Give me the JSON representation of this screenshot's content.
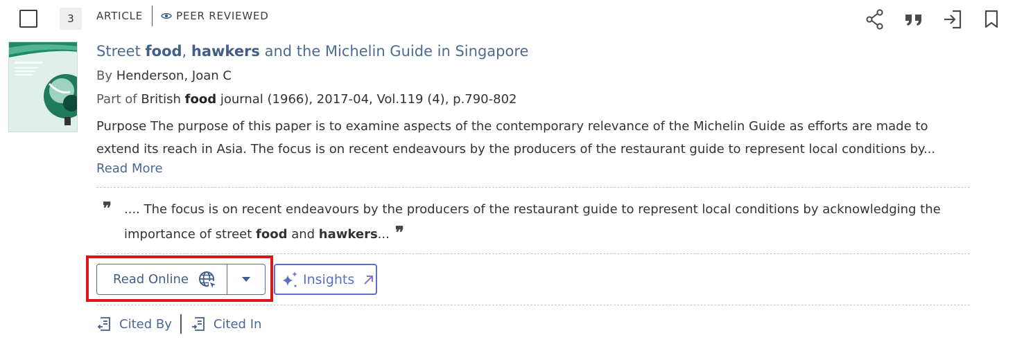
{
  "result": {
    "index": "3",
    "type_label": "ARTICLE",
    "peer_label": "PEER REVIEWED",
    "title": {
      "p1": "Street ",
      "b1": "food",
      "p2": ", ",
      "b2": "hawkers",
      "p3": " and the Michelin Guide in Singapore"
    },
    "byline": {
      "prefix": "By",
      "author": "Henderson, Joan C"
    },
    "part_of": {
      "prefix": "Part of",
      "s1": "British ",
      "bold": "food",
      "s2": " journal (1966), 2017-04, Vol.119 (4), p.790-802"
    },
    "abstract": {
      "line1": "Purpose The purpose of this paper is to examine aspects of the contemporary relevance of the Michelin Guide as efforts are made to",
      "line2": "extend its reach in Asia. The focus is on recent endeavours by the producers of the restaurant guide to represent local conditions by..."
    },
    "read_more": "Read More",
    "snippet": {
      "quote_mark": "❞",
      "line1": ".... The focus is on recent endeavours by the producers of the restaurant guide to represent local conditions by acknowledging the",
      "l2a": "importance of street ",
      "b1": "food",
      "l2b": " and ",
      "b2": "hawkers",
      "l2c": "..."
    },
    "read_online_label": "Read Online",
    "insights_label": "Insights",
    "cited_by_label": "Cited By",
    "cited_in_label": "Cited In"
  },
  "icons": {
    "peer": "eye-icon",
    "share": "share-icon",
    "cite": "quote-icon",
    "export": "export-icon",
    "bookmark": "bookmark-icon",
    "globe": "globe-cursor-icon",
    "dropdown": "caret-down-icon",
    "insights": "sparkle-icon",
    "external": "arrow-up-right-icon",
    "cited_by": "cited-by-icon",
    "cited_in": "cited-in-icon"
  },
  "colors": {
    "link": "#3f5e88",
    "highlight": "#e0151b",
    "insights": "#5b6fc0",
    "thumb_green": "#1f8a6a"
  }
}
